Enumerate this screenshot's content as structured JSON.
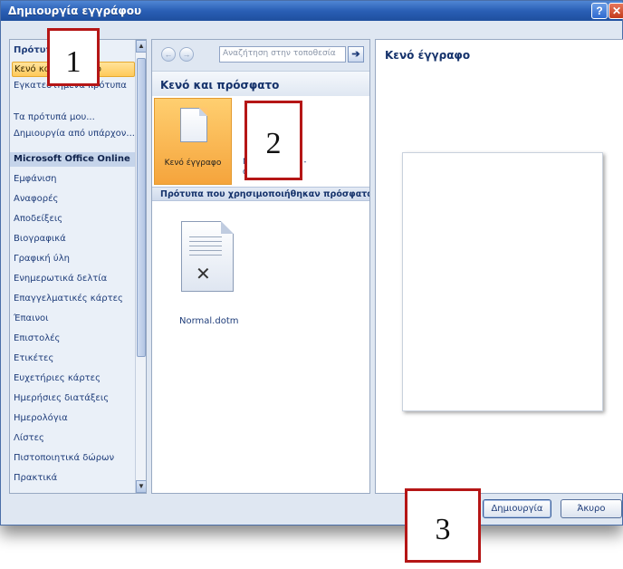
{
  "window": {
    "title": "Δημιουργία εγγράφου"
  },
  "titlebar": {
    "help_glyph": "?",
    "close_glyph": "✕"
  },
  "sidebar": {
    "items": [
      {
        "label": "Πρότυπα",
        "type": "header"
      },
      {
        "label": "Κενό και πρόσφατο",
        "type": "selected"
      },
      {
        "label": "Εγκατεστημένα πρότυπα",
        "type": "normal"
      },
      {
        "label": "Τα πρότυπά μου...",
        "type": "normal"
      },
      {
        "label": "Δημιουργία από υπάρχον...",
        "type": "normal"
      },
      {
        "label": "Microsoft Office Online",
        "type": "section"
      },
      {
        "label": "Εμφάνιση",
        "type": "normal"
      },
      {
        "label": "Αναφορές",
        "type": "normal"
      },
      {
        "label": "Αποδείξεις",
        "type": "normal"
      },
      {
        "label": "Βιογραφικά",
        "type": "normal"
      },
      {
        "label": "Γραφική ύλη",
        "type": "normal"
      },
      {
        "label": "Ενημερωτικά δελτία",
        "type": "normal"
      },
      {
        "label": "Επαγγελματικές κάρτες",
        "type": "normal"
      },
      {
        "label": "Έπαινοι",
        "type": "normal"
      },
      {
        "label": "Επιστολές",
        "type": "normal"
      },
      {
        "label": "Ετικέτες",
        "type": "normal"
      },
      {
        "label": "Ευχετήριες κάρτες",
        "type": "normal"
      },
      {
        "label": "Ημερήσιες διατάξεις",
        "type": "normal"
      },
      {
        "label": "Ημερολόγια",
        "type": "normal"
      },
      {
        "label": "Λίστες",
        "type": "normal"
      },
      {
        "label": "Πιστοποιητικά δώρων",
        "type": "normal"
      },
      {
        "label": "Πρακτικά",
        "type": "normal"
      }
    ]
  },
  "toolbar": {
    "back_glyph": "←",
    "forward_glyph": "→",
    "search_placeholder": "Αναζήτηση στην τοποθεσία",
    "search_go_glyph": "➔"
  },
  "middle": {
    "section_title": "Κενό και πρόσφατο",
    "tiles": [
      {
        "label": "Κενό έγγραφο"
      },
      {
        "label": "Νέο ιστολόγιο - ανάρτηση"
      }
    ],
    "recent_title": "Πρότυπα που χρησιμοποιήθηκαν πρόσφατα",
    "recent_items": [
      {
        "label": "Normal.dotm",
        "mark": "✕"
      }
    ]
  },
  "preview": {
    "title": "Κενό έγγραφο"
  },
  "footer": {
    "create_label": "Δημιουργία",
    "cancel_label": "Άκυρο"
  },
  "callouts": [
    "1",
    "2",
    "3"
  ]
}
